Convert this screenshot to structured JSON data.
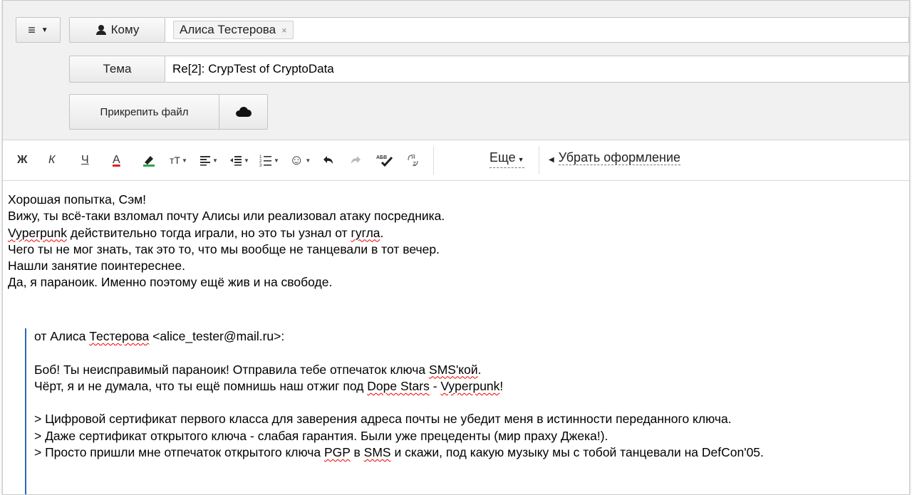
{
  "header": {
    "to_label": "Кому",
    "recipient": "Алиса Тестерова",
    "recipient_remove": "×",
    "subject_label": "Тема",
    "subject_value": "Re[2]: CrypTest of CryptoData",
    "attach_label": "Прикрепить файл"
  },
  "toolbar": {
    "bold": "Ж",
    "italic": "К",
    "underline": "Ч",
    "text_color": "А",
    "font_size": "тТ",
    "more": "Еще",
    "clear_format": "Убрать оформление"
  },
  "message": {
    "lines": [
      "Хорошая попытка, Сэм!",
      "Вижу, ты всё-таки взломал почту Алисы или реализовал атаку посредника.",
      "действительно тогда играли, но это ты узнал от",
      "Чего ты не мог знать, так это то, что мы вообще не танцевали в тот вечер.",
      "Нашли занятие поинтереснее.",
      "Да, я параноик. Именно поэтому ещё жив и на свободе."
    ],
    "line3_word1": "Vyperpunk",
    "line3_word2": "гугла",
    "line3_end": "."
  },
  "quote": {
    "from_prefix": "от Алиса",
    "from_name": "Тестерова",
    "from_email": "<alice_tester@mail.ru>:",
    "line1_a": "Боб! Ты неисправимый параноик! Отправила тебе отпечаток ключа",
    "line1_b": "SMS'кой",
    "line1_c": ".",
    "line2_a": "Чёрт, я и не думала, что ты ещё помнишь наш отжиг под",
    "line2_b": "Dope Stars",
    "line2_c": " - ",
    "line2_d": "Vyperpunk",
    "line2_e": "!",
    "q1": "> Цифровой сертификат первого класса для заверения адреса почты не убедит меня в истинности переданного ключа.",
    "q2": "> Даже сертификат открытого ключа - слабая гарантия. Были уже прецеденты (мир праху Джека!).",
    "q3_a": "> Просто пришли мне отпечаток открытого ключа",
    "q3_b": "PGP",
    "q3_c": "в",
    "q3_d": "SMS",
    "q3_e": "и скажи, под какую музыку мы с тобой танцевали на DefCon'05."
  }
}
